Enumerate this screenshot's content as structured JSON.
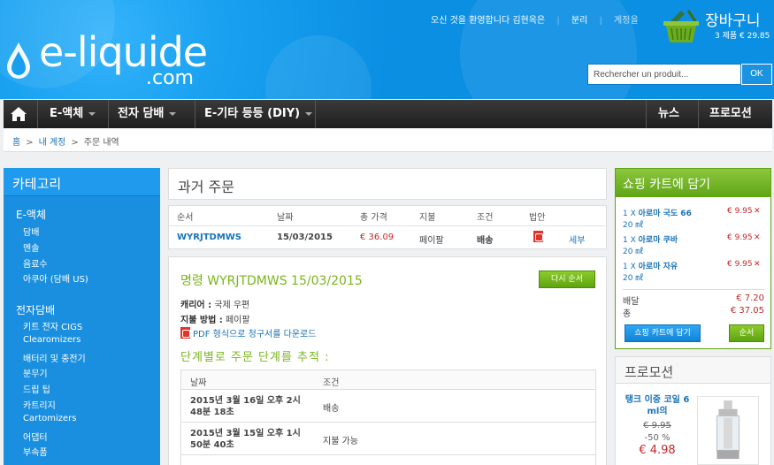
{
  "header": {
    "logo_main": "e-liquide",
    "logo_sub": ".com",
    "welcome": "오신 것을 환영합니다 김현옥은",
    "logout": "분리",
    "account": "계정을",
    "cart_title": "장바구니",
    "cart_summary": "3 제품 € 29.85",
    "search_placeholder": "Rechercher un produit...",
    "search_button": "OK"
  },
  "nav": {
    "items": [
      "E-액체",
      "전자 담배",
      "E-기타 등등 (DIY)",
      "뉴스",
      "프로모션"
    ]
  },
  "breadcrumb": {
    "home": "홈",
    "account": "내 계정",
    "current": "주문 내역"
  },
  "sidebar": {
    "title": "카테고리",
    "groups": [
      {
        "label": "E-액체",
        "items": [
          "담배",
          "멘솔",
          "음료수",
          "아쿠아 (담배 US)"
        ]
      },
      {
        "label": "전자담배",
        "items": [
          "키트 전자 CIGS",
          "Clearomizers",
          "배터리 및 충전기",
          "분무기",
          "드립 팁",
          "카트리지",
          "Cartomizers",
          "어댑터",
          "부속품"
        ]
      }
    ]
  },
  "main": {
    "title": "과거 주문",
    "orders_headers": [
      "순서",
      "날짜",
      "총 가격",
      "지불",
      "조건",
      "법안"
    ],
    "order": {
      "ref": "WYRJTDMWS",
      "date": "15/03/2015",
      "total": "€ 36.09",
      "payment": "페이팔",
      "status": "배송",
      "details_link": "세부"
    },
    "detail": {
      "title": "명령 WYRJTDMWS 15/03/2015",
      "reorder": "다시 순서",
      "carrier_label": "캐리어 :",
      "carrier_value": "국제 우편",
      "payment_label": "지불 방법 :",
      "payment_value": "페이팔",
      "pdf_link": "PDF 형식으로 청구서를 다운로드",
      "track_title": "단계별로 주문 단계를 추적 :",
      "track_headers": [
        "날짜",
        "조건"
      ],
      "track_rows": [
        {
          "date": "2015년 3월 16일 오후 2시 48분 18초",
          "status": "배송"
        },
        {
          "date": "2015년 3월 15일 오후 1시 50분 40초",
          "status": "지불 가능"
        }
      ]
    }
  },
  "right_cart": {
    "title": "쇼핑 카트에 담기",
    "items": [
      {
        "qty": "1 X",
        "name": "아로마 국도 66",
        "ml": "20 ㎖",
        "price": "€ 9.95"
      },
      {
        "qty": "1 X",
        "name": "아로마 쿠바",
        "ml": "20 ㎖",
        "price": "€ 9.95"
      },
      {
        "qty": "1 X",
        "name": "아로마 자유",
        "ml": "20 ㎖",
        "price": "€ 9.95"
      }
    ],
    "shipping_label": "배달",
    "shipping_value": "€ 7.20",
    "total_label": "총",
    "total_value": "€ 37.05",
    "view_cart": "쇼핑 카트에 담기",
    "checkout": "순서"
  },
  "promo": {
    "title": "프로모션",
    "name": "탱크 이중 코일 6 ml의",
    "old_price": "€ 9.95",
    "discount": "-50 %",
    "new_price": "€ 4.98"
  },
  "colors": {
    "header_blue": "#0a8fe3",
    "accent_green": "#7ab51d",
    "price_red": "#c62828",
    "link_blue": "#1a73b8"
  }
}
